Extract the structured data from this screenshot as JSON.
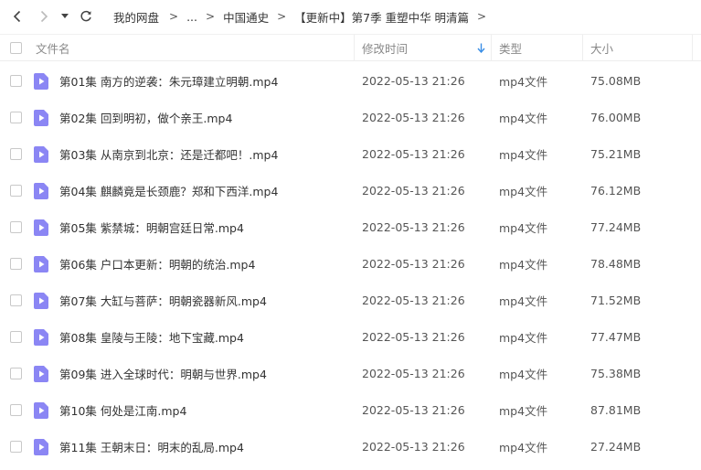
{
  "breadcrumb": {
    "items": [
      "我的网盘",
      "...",
      "中国通史",
      "【更新中】第7季 重塑中华 明清篇"
    ],
    "separator": ">"
  },
  "columns": {
    "name": "文件名",
    "modified": "修改时间",
    "type": "类型",
    "size": "大小"
  },
  "colors": {
    "file_icon": "#8b86f4",
    "sort_arrow": "#3a8ee6"
  },
  "files": [
    {
      "name": "第01集 南方的逆袭：朱元璋建立明朝.mp4",
      "modified": "2022-05-13 21:26",
      "type": "mp4文件",
      "size": "75.08MB"
    },
    {
      "name": "第02集 回到明初，做个亲王.mp4",
      "modified": "2022-05-13 21:26",
      "type": "mp4文件",
      "size": "76.00MB"
    },
    {
      "name": "第03集 从南京到北京：还是迁都吧！.mp4",
      "modified": "2022-05-13 21:26",
      "type": "mp4文件",
      "size": "75.21MB"
    },
    {
      "name": "第04集 麒麟竟是长颈鹿？郑和下西洋.mp4",
      "modified": "2022-05-13 21:26",
      "type": "mp4文件",
      "size": "76.12MB"
    },
    {
      "name": "第05集 紫禁城：明朝宫廷日常.mp4",
      "modified": "2022-05-13 21:26",
      "type": "mp4文件",
      "size": "77.24MB"
    },
    {
      "name": "第06集 户口本更新：明朝的统治.mp4",
      "modified": "2022-05-13 21:26",
      "type": "mp4文件",
      "size": "78.48MB"
    },
    {
      "name": "第07集 大缸与菩萨：明朝瓷器新风.mp4",
      "modified": "2022-05-13 21:26",
      "type": "mp4文件",
      "size": "71.52MB"
    },
    {
      "name": "第08集 皇陵与王陵：地下宝藏.mp4",
      "modified": "2022-05-13 21:26",
      "type": "mp4文件",
      "size": "77.47MB"
    },
    {
      "name": "第09集 进入全球时代：明朝与世界.mp4",
      "modified": "2022-05-13 21:26",
      "type": "mp4文件",
      "size": "75.38MB"
    },
    {
      "name": "第10集 何处是江南.mp4",
      "modified": "2022-05-13 21:26",
      "type": "mp4文件",
      "size": "87.81MB"
    },
    {
      "name": "第11集 王朝末日：明末的乱局.mp4",
      "modified": "2022-05-13 21:26",
      "type": "mp4文件",
      "size": "27.24MB"
    }
  ]
}
